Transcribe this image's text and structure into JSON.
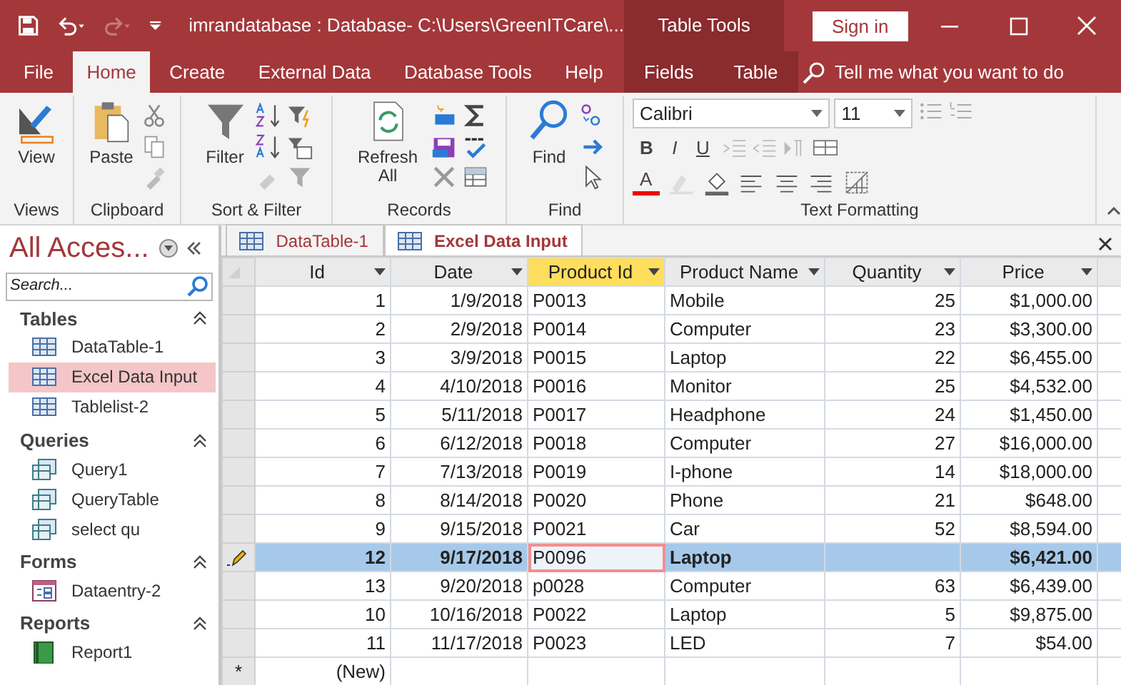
{
  "window": {
    "title": "imrandatabase : Database- C:\\Users\\GreenITCare\\...",
    "context_header": "Table Tools",
    "sign_in": "Sign in",
    "redo_disabled": true
  },
  "ribbon_tabs": [
    {
      "label": "File",
      "selected": false,
      "contextual": false
    },
    {
      "label": "Home",
      "selected": true,
      "contextual": false
    },
    {
      "label": "Create",
      "selected": false,
      "contextual": false
    },
    {
      "label": "External Data",
      "selected": false,
      "contextual": false
    },
    {
      "label": "Database Tools",
      "selected": false,
      "contextual": false
    },
    {
      "label": "Help",
      "selected": false,
      "contextual": false
    },
    {
      "label": "Fields",
      "selected": false,
      "contextual": true
    },
    {
      "label": "Table",
      "selected": false,
      "contextual": true
    }
  ],
  "tell_me": {
    "placeholder": "Tell me what you want to do"
  },
  "ribbon_groups": [
    {
      "kind": "views",
      "label": "Views",
      "buttons": [
        {
          "kind": "view",
          "label": "View"
        }
      ]
    },
    {
      "kind": "clipboard",
      "label": "Clipboard",
      "buttons": [
        {
          "kind": "paste",
          "label": "Paste"
        }
      ]
    },
    {
      "kind": "sort",
      "label": "Sort & Filter",
      "buttons": [
        {
          "kind": "filter",
          "label": "Filter"
        }
      ]
    },
    {
      "kind": "records",
      "label": "Records",
      "buttons": [
        {
          "kind": "refresh",
          "label": "Refresh All"
        }
      ]
    },
    {
      "kind": "find",
      "label": "Find",
      "buttons": [
        {
          "kind": "find",
          "label": "Find"
        }
      ]
    },
    {
      "kind": "text",
      "label": "Text Formatting",
      "font": "Calibri",
      "size": "11",
      "style_buttons": [
        "B",
        "I",
        "U"
      ],
      "font_color": "A"
    }
  ],
  "navigation": {
    "title": "All Acces...",
    "search": {
      "placeholder": "Search..."
    },
    "groups": [
      {
        "kind": "table",
        "label": "Tables",
        "expanded": true,
        "items": [
          {
            "label": "DataTable-1",
            "selected": false
          },
          {
            "label": "Excel Data Input",
            "selected": true
          },
          {
            "label": "Tablelist-2",
            "selected": false
          }
        ]
      },
      {
        "kind": "query",
        "label": "Queries",
        "expanded": true,
        "items": [
          {
            "label": "Query1",
            "selected": false
          },
          {
            "label": "QueryTable",
            "selected": false
          },
          {
            "label": "select qu",
            "selected": false
          }
        ]
      },
      {
        "kind": "form",
        "label": "Forms",
        "expanded": true,
        "items": [
          {
            "label": "Dataentry-2",
            "selected": false
          }
        ]
      },
      {
        "kind": "report",
        "label": "Reports",
        "expanded": true,
        "items": [
          {
            "label": "Report1",
            "selected": false
          }
        ]
      }
    ]
  },
  "document_tabs": [
    {
      "label": "DataTable-1",
      "selected": false
    },
    {
      "label": "Excel Data Input",
      "selected": true
    }
  ],
  "table": {
    "columns": [
      {
        "label": "Id",
        "kind": "number",
        "selected": false
      },
      {
        "label": "Date",
        "kind": "number",
        "selected": false
      },
      {
        "label": "Product Id",
        "kind": "text",
        "selected": true
      },
      {
        "label": "Product Name",
        "kind": "text",
        "selected": false
      },
      {
        "label": "Quantity",
        "kind": "number",
        "selected": false
      },
      {
        "label": "Price",
        "kind": "number",
        "selected": false
      }
    ],
    "rows": [
      {
        "cells": [
          "1",
          "1/9/2018",
          "P0013",
          "Mobile",
          "25",
          "$1,000.00"
        ],
        "selected": false
      },
      {
        "cells": [
          "2",
          "2/9/2018",
          "P0014",
          "Computer",
          "23",
          "$3,300.00"
        ],
        "selected": false
      },
      {
        "cells": [
          "3",
          "3/9/2018",
          "P0015",
          "Laptop",
          "22",
          "$6,455.00"
        ],
        "selected": false
      },
      {
        "cells": [
          "4",
          "4/10/2018",
          "P0016",
          "Monitor",
          "25",
          "$4,532.00"
        ],
        "selected": false
      },
      {
        "cells": [
          "5",
          "5/11/2018",
          "P0017",
          "Headphone",
          "24",
          "$1,450.00"
        ],
        "selected": false
      },
      {
        "cells": [
          "6",
          "6/12/2018",
          "P0018",
          "Computer",
          "27",
          "$16,000.00"
        ],
        "selected": false
      },
      {
        "cells": [
          "7",
          "7/13/2018",
          "P0019",
          "I-phone",
          "14",
          "$18,000.00"
        ],
        "selected": false
      },
      {
        "cells": [
          "8",
          "8/14/2018",
          "P0020",
          "Phone",
          "21",
          "$648.00"
        ],
        "selected": false
      },
      {
        "cells": [
          "9",
          "9/15/2018",
          "P0021",
          "Car",
          "52",
          "$8,594.00"
        ],
        "selected": false
      },
      {
        "cells": [
          "12",
          "9/17/2018",
          "P0096",
          "Laptop",
          "",
          "$6,421.00"
        ],
        "selected": true
      },
      {
        "cells": [
          "13",
          "9/20/2018",
          "p0028",
          "Computer",
          "63",
          "$6,439.00"
        ],
        "selected": false
      },
      {
        "cells": [
          "10",
          "10/16/2018",
          "P0022",
          "Laptop",
          "5",
          "$9,875.00"
        ],
        "selected": false
      },
      {
        "cells": [
          "11",
          "11/17/2018",
          "P0023",
          "LED",
          "7",
          "$54.00"
        ],
        "selected": false
      }
    ],
    "new_row": {
      "marker": "*",
      "label": "(New)"
    }
  }
}
